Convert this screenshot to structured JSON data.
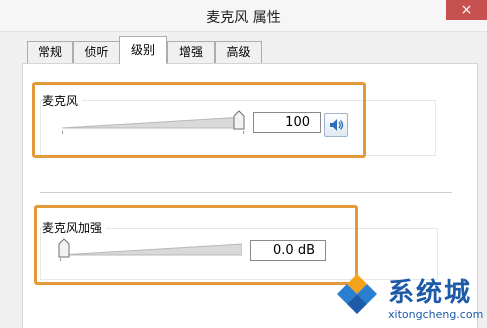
{
  "window": {
    "title": "麦克风 属性",
    "close_glyph": "×"
  },
  "tabs": [
    {
      "label": "常规",
      "active": false
    },
    {
      "label": "侦听",
      "active": false
    },
    {
      "label": "级别",
      "active": true
    },
    {
      "label": "增强",
      "active": false
    },
    {
      "label": "高级",
      "active": false
    }
  ],
  "microphone": {
    "label": "麦克风",
    "value_text": "100",
    "level_fraction": 1.0,
    "mute_icon": "speaker-icon"
  },
  "boost": {
    "label": "麦克风加强",
    "value_text": "0.0 dB",
    "level_fraction": 0.0
  },
  "watermark": {
    "brand": "系统城",
    "url": "xitongcheng.com"
  },
  "colors": {
    "highlight": "#e39a3a",
    "close_button": "#c75050",
    "brand_blue": "#1d5aa8"
  }
}
